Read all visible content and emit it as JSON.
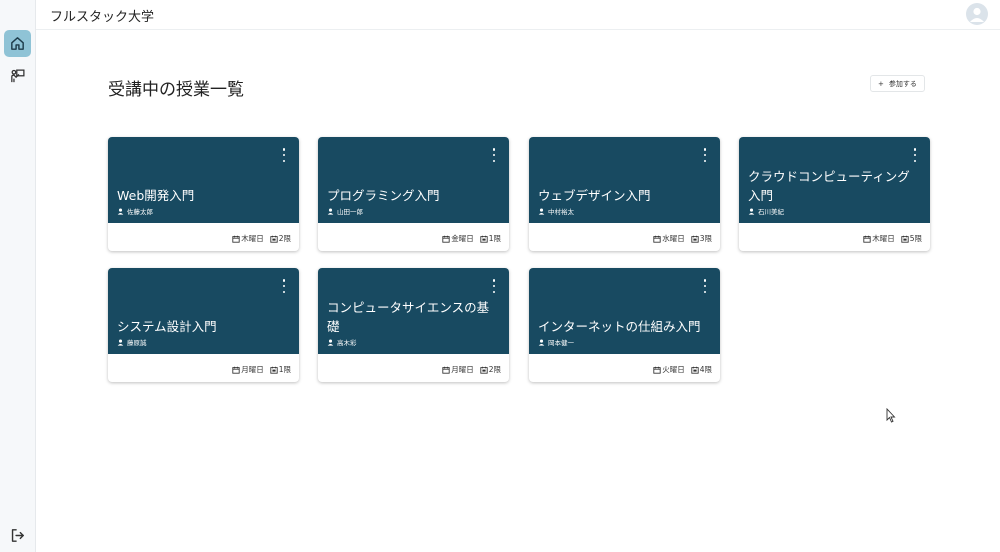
{
  "header": {
    "app_title": "フルスタック大学"
  },
  "sidebar": {
    "items": [
      {
        "icon": "home-icon"
      },
      {
        "icon": "classroom-icon"
      },
      {
        "icon": "logout-icon"
      }
    ]
  },
  "main": {
    "title": "受講中の授業一覧",
    "join_button": {
      "icon": "+",
      "label": "参加する"
    },
    "courses": [
      {
        "title": "Web開発入門",
        "teacher": "佐藤太郎",
        "day": "木曜日",
        "period": "2限"
      },
      {
        "title": "プログラミング入門",
        "teacher": "山田一郎",
        "day": "金曜日",
        "period": "1限"
      },
      {
        "title": "ウェブデザイン入門",
        "teacher": "中村裕太",
        "day": "水曜日",
        "period": "3限"
      },
      {
        "title": "クラウドコンピューティング入門",
        "teacher": "石川美紀",
        "day": "木曜日",
        "period": "5限"
      },
      {
        "title": "システム設計入門",
        "teacher": "藤原誠",
        "day": "月曜日",
        "period": "1限"
      },
      {
        "title": "コンピュータサイエンスの基礎",
        "teacher": "高木彩",
        "day": "月曜日",
        "period": "2限"
      },
      {
        "title": "インターネットの仕組み入門",
        "teacher": "岡本健一",
        "day": "火曜日",
        "period": "4限"
      }
    ]
  },
  "colors": {
    "accent": "#8fc3d6",
    "card_header": "#184a61"
  }
}
